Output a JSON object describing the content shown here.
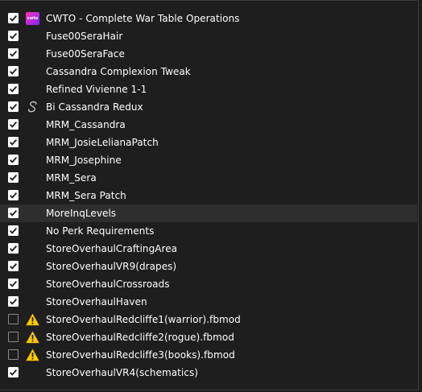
{
  "mods": [
    {
      "name": "CWTO - Complete War Table Operations",
      "checked": true,
      "icon": "cwto-logo-icon",
      "badge_text": "cwto"
    },
    {
      "name": "Fuse00SeraHair",
      "checked": true,
      "icon": ""
    },
    {
      "name": "Fuse00SeraFace",
      "checked": true,
      "icon": ""
    },
    {
      "name": "Cassandra Complexion Tweak",
      "checked": true,
      "icon": ""
    },
    {
      "name": "Refined Vivienne 1-1",
      "checked": true,
      "icon": ""
    },
    {
      "name": "Bi Cassandra Redux",
      "checked": true,
      "icon": "script-s-icon"
    },
    {
      "name": "MRM_Cassandra",
      "checked": true,
      "icon": ""
    },
    {
      "name": "MRM_JosieLelianaPatch",
      "checked": true,
      "icon": ""
    },
    {
      "name": "MRM_Josephine",
      "checked": true,
      "icon": ""
    },
    {
      "name": "MRM_Sera",
      "checked": true,
      "icon": ""
    },
    {
      "name": "MRM_Sera Patch",
      "checked": true,
      "icon": ""
    },
    {
      "name": "MoreInqLevels",
      "checked": true,
      "icon": "",
      "highlighted": true
    },
    {
      "name": "No Perk Requirements",
      "checked": true,
      "icon": ""
    },
    {
      "name": "StoreOverhaulCraftingArea",
      "checked": true,
      "icon": ""
    },
    {
      "name": "StoreOverhaulVR9(drapes)",
      "checked": true,
      "icon": ""
    },
    {
      "name": "StoreOverhaulCrossroads",
      "checked": true,
      "icon": ""
    },
    {
      "name": "StoreOverhaulHaven",
      "checked": true,
      "icon": ""
    },
    {
      "name": "StoreOverhaulRedcliffe1(warrior).fbmod",
      "checked": false,
      "icon": "warning-icon"
    },
    {
      "name": "StoreOverhaulRedcliffe2(rogue).fbmod",
      "checked": false,
      "icon": "warning-icon"
    },
    {
      "name": "StoreOverhaulRedcliffe3(books).fbmod",
      "checked": false,
      "icon": "warning-icon"
    },
    {
      "name": "StoreOverhaulVR4(schematics)",
      "checked": true,
      "icon": ""
    }
  ],
  "colors": {
    "background": "#1e1e1e",
    "row_highlight": "#2e2e2e",
    "warning": "#ffcc00",
    "text": "#ffffff"
  }
}
